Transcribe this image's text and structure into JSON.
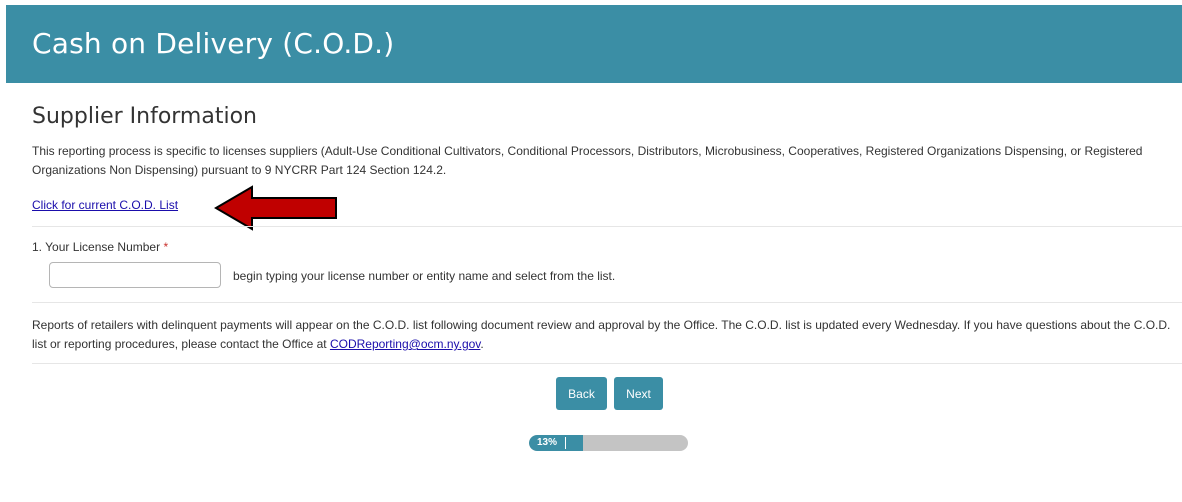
{
  "header": {
    "title": "Cash on Delivery (C.O.D.)"
  },
  "section": {
    "title": "Supplier Information",
    "intro": "This reporting process is specific to licenses suppliers (Adult-Use Conditional Cultivators, Conditional Processors, Distributors, Microbusiness, Cooperatives, Registered Organizations Dispensing, or Registered Organizations Non Dispensing) pursuant to 9 NYCRR Part 124 Section 124.2.",
    "cod_link": "Click for current C.O.D. List"
  },
  "question": {
    "label": "1. Your License Number",
    "required_marker": "*",
    "input_value": "",
    "input_placeholder": "",
    "help": "begin typing your license number or entity name and select from the list."
  },
  "note": {
    "text_before": "Reports of retailers with delinquent payments will appear on the C.O.D. list following document review and approval by the Office. The C.O.D. list is updated every Wednesday. If you have questions about the C.O.D. list or reporting procedures, please contact the Office at ",
    "email": "CODReporting@ocm.ny.gov",
    "text_after": "."
  },
  "buttons": {
    "back": "Back",
    "next": "Next"
  },
  "progress": {
    "value": 0.13,
    "label": "13%"
  },
  "colors": {
    "accent": "#3b8ea5",
    "arrow": "#c00000",
    "link": "#1a0dab",
    "required": "#c9302c"
  }
}
